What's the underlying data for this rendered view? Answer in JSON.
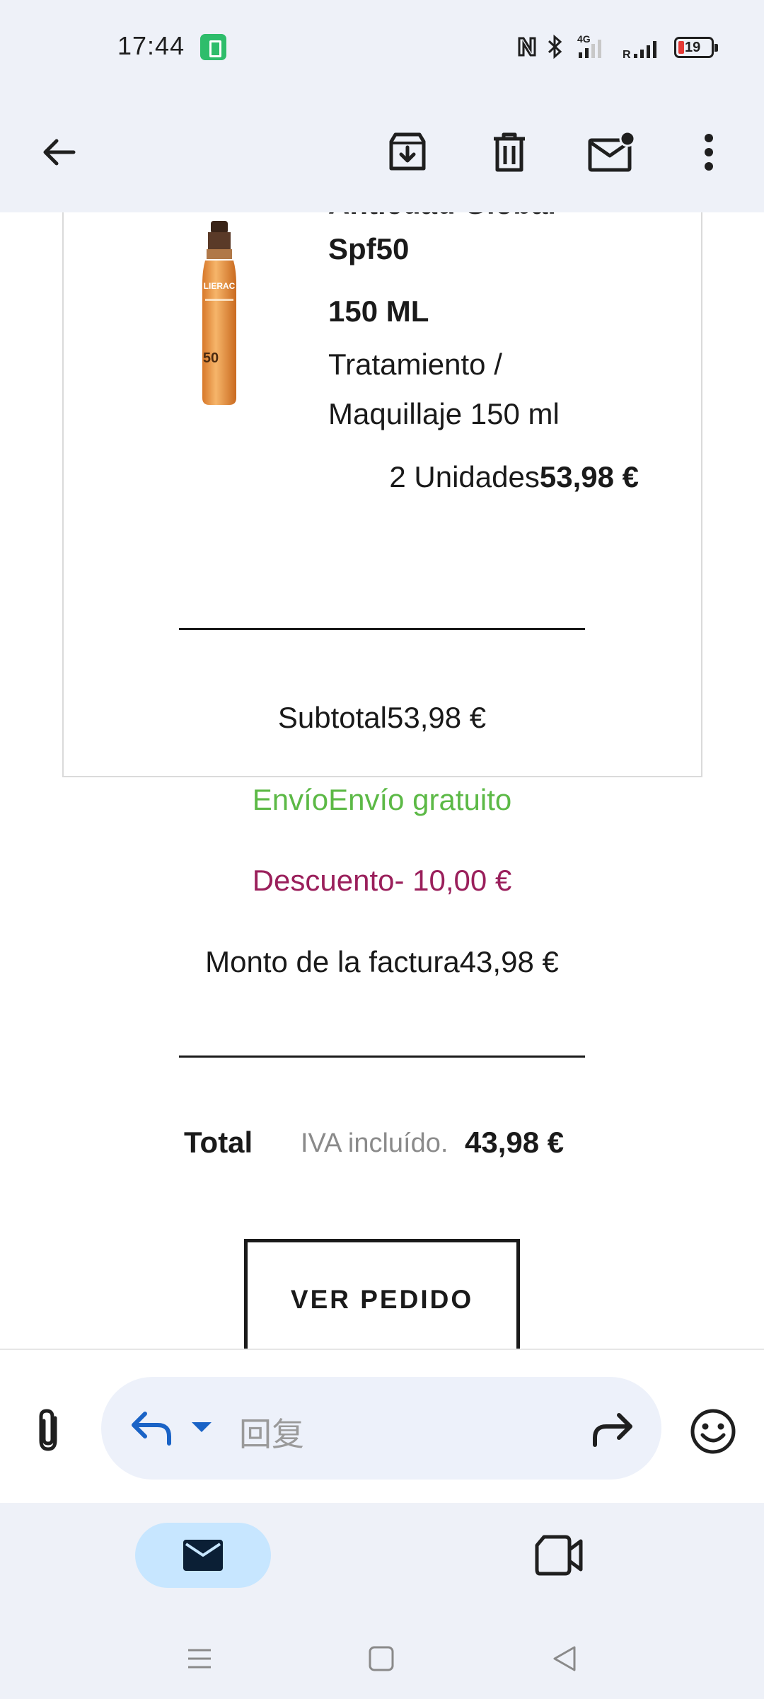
{
  "status_bar": {
    "time": "17:44",
    "battery_level": "19",
    "network_label": "4G",
    "roaming_label": "R"
  },
  "app_bar": {
    "icons": [
      "back-arrow-icon",
      "archive-icon",
      "trash-icon",
      "mark-unread-icon",
      "more-vert-icon"
    ]
  },
  "product": {
    "name_line1": "Antiedad Global",
    "name_line2": "Spf50",
    "size": "150 ML",
    "description": "Tratamiento / Maquillaje 150 ml",
    "quantity": "2 Unidades",
    "price": "53,98 €",
    "image_brand": "LIERAC",
    "image_spf": "50"
  },
  "summary": {
    "subtotal_label": "Subtotal",
    "subtotal_value": "53,98 €",
    "shipping_label": "Envío",
    "shipping_value": "Envío gratuito",
    "discount_label": "Descuento",
    "discount_value": "- 10,00 €",
    "invoice_label": "Monto de la factura",
    "invoice_value": "43,98 €"
  },
  "total": {
    "label": "Total",
    "vat_note": "IVA incluído.",
    "value": "43,98 €"
  },
  "view_order_button": "VER PEDIDO",
  "reply_bar": {
    "placeholder": "回复"
  },
  "colors": {
    "shipping_green": "#5cb946",
    "discount_magenta": "#9a1f5b",
    "accent_blue": "#1a63c6",
    "nav_active": "#c7e6ff",
    "top_bg": "#eef1f8"
  }
}
